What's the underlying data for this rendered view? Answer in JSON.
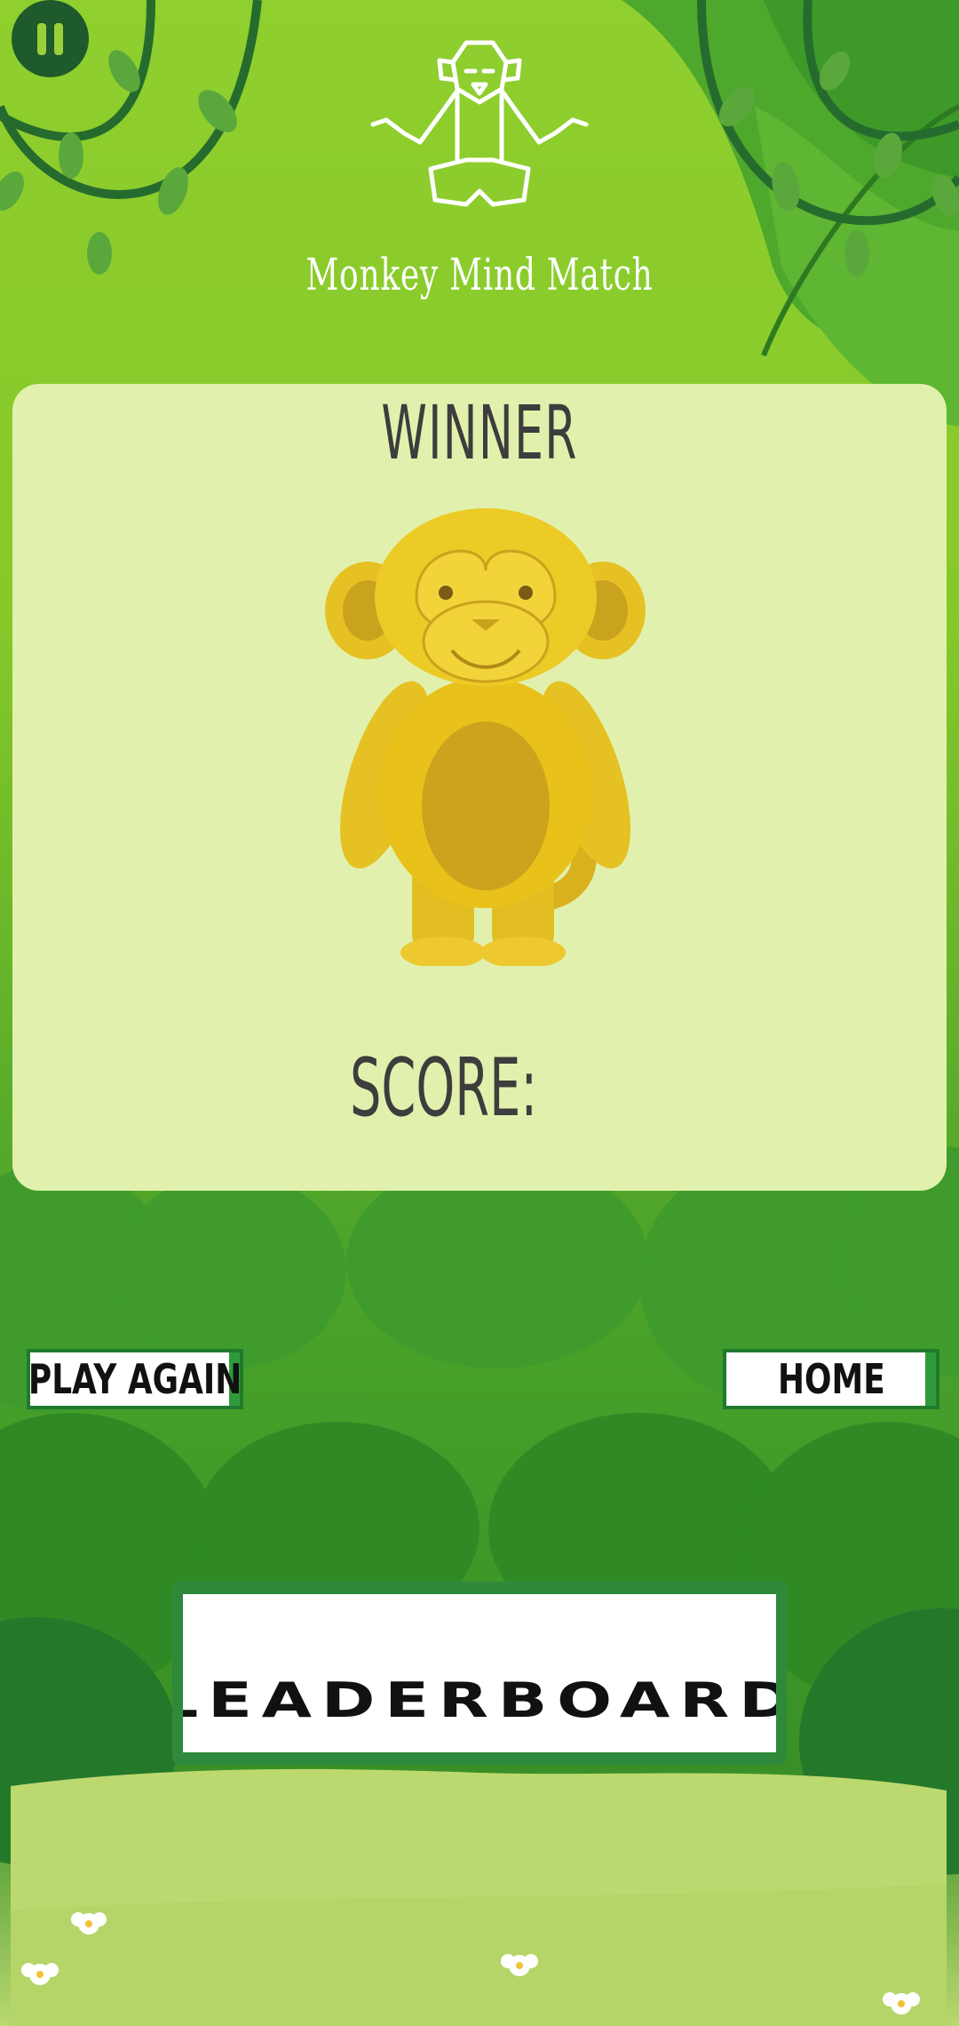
{
  "app": {
    "title": "Monkey Mind Match"
  },
  "result": {
    "heading": "WINNER",
    "score_label": "SCORE:",
    "score_value": ""
  },
  "buttons": {
    "play_again": "PLAY AGAIN",
    "home": "HOME",
    "leaderboard": "LEADERBOARD"
  },
  "icons": {
    "pause": "pause-icon",
    "logo": "meditating-monkey-logo",
    "trophy": "gold-monkey-trophy"
  },
  "colors": {
    "panel": "#e1f1ad",
    "accent_dark_green": "#1e5a2c",
    "trophy_gold": "#e8c21a",
    "button_border": "#1f7a2e"
  }
}
